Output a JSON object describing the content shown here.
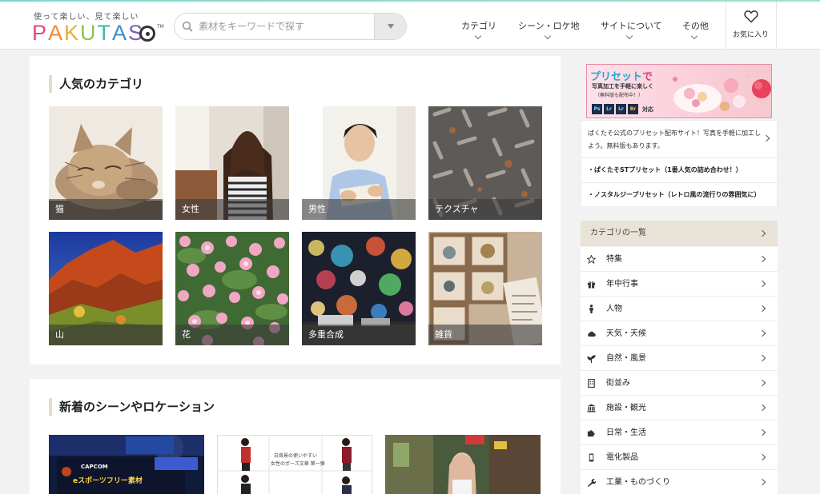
{
  "header": {
    "tagline": "使って楽しい、見て楽しい",
    "logo_letters": [
      "P",
      "A",
      "K",
      "U",
      "T",
      "A",
      "S"
    ],
    "logo_colors": [
      "#e3497d",
      "#f08a3c",
      "#e7b22f",
      "#8bc34a",
      "#3cb8a8",
      "#3a8fd0",
      "#7a5bb8"
    ],
    "search_placeholder": "素材をキーワードで探す",
    "nav": [
      "カテゴリ",
      "シーン・ロケ地",
      "サイトについて",
      "その他"
    ],
    "favorites_label": "お気に入り"
  },
  "popular": {
    "title": "人気のカテゴリ",
    "items": [
      "猫",
      "女性",
      "男性",
      "テクスチャ",
      "山",
      "花",
      "多重合成",
      "雑貨"
    ]
  },
  "new_scenes": {
    "title": "新着のシーンやロケーション",
    "banner_title": "eスポーツフリー素材",
    "banner_brand": "CAPCOM",
    "poster_line1": "白背景の使いやすい",
    "poster_line2": "女性のポーズ文章 第一弾"
  },
  "sidebar": {
    "ad": {
      "title_prefix": "プリセット",
      "title_suffix": "で",
      "line1": "写真加工を手軽に楽しく",
      "line2": "（無料版も配布中！）",
      "apps": [
        "Ps",
        "Lr",
        "Lr",
        "Br"
      ],
      "apps_suffix": "対応"
    },
    "promo_text": "ぱくたそ公式のプリセット配布サイト！写真を手軽に加工しよう。無料版もあります。",
    "promo_links": [
      "・ぱくたそSTプリセット（1番人気の詰め合わせ！）",
      "・ノスタルジープリセット（レトロ風の流行りの雰囲気に）"
    ],
    "category_heading": "カテゴリの一覧",
    "categories": [
      "特集",
      "年中行事",
      "人物",
      "天気・天候",
      "自然・風景",
      "街並み",
      "施設・観光",
      "日常・生活",
      "電化製品",
      "工業・ものづくり"
    ]
  }
}
